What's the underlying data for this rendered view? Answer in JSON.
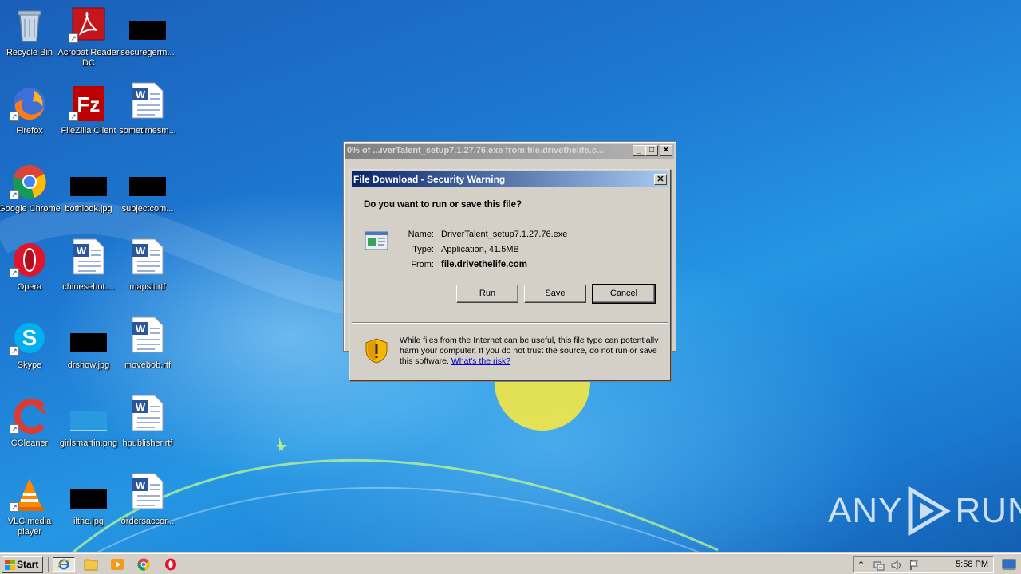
{
  "desktop": {
    "icons": [
      {
        "label": "Recycle Bin",
        "icon": "recycle-bin-icon"
      },
      {
        "label": "Acrobat Reader DC",
        "icon": "acrobat-reader-icon"
      },
      {
        "label": "securegerm...",
        "icon": "image-thumbnail-icon"
      },
      {
        "label": "Firefox",
        "icon": "firefox-icon"
      },
      {
        "label": "FileZilla Client",
        "icon": "filezilla-icon"
      },
      {
        "label": "sometimesm...",
        "icon": "word-document-icon"
      },
      {
        "label": "Google Chrome",
        "icon": "chrome-icon"
      },
      {
        "label": "bothlook.jpg",
        "icon": "image-thumbnail-icon"
      },
      {
        "label": "subjectcom...",
        "icon": "image-thumbnail-icon"
      },
      {
        "label": "Opera",
        "icon": "opera-icon"
      },
      {
        "label": "chinesehot....",
        "icon": "word-document-icon"
      },
      {
        "label": "mapsit.rtf",
        "icon": "word-document-icon"
      },
      {
        "label": "Skype",
        "icon": "skype-icon"
      },
      {
        "label": "drshow.jpg",
        "icon": "image-thumbnail-icon"
      },
      {
        "label": "movebob.rtf",
        "icon": "word-document-icon"
      },
      {
        "label": "CCleaner",
        "icon": "ccleaner-icon"
      },
      {
        "label": "girlsmartin.png",
        "icon": "image-thumbnail-icon"
      },
      {
        "label": "hpublisher.rtf",
        "icon": "word-document-icon"
      },
      {
        "label": "VLC media player",
        "icon": "vlc-icon"
      },
      {
        "label": "ilthe.jpg",
        "icon": "image-thumbnail-icon"
      },
      {
        "label": "ordersaccor...",
        "icon": "word-document-icon"
      }
    ]
  },
  "watermark": {
    "left": "ANY",
    "right": "RUN"
  },
  "ie_window": {
    "title": "0% of ...iverTalent_setup7.1.27.76.exe from file.drivethelife.c...",
    "minimize": "_",
    "maximize": "□",
    "close": "✕"
  },
  "dialog": {
    "title": "File Download - Security Warning",
    "close": "✕",
    "question": "Do you want to run or save this file?",
    "name_label": "Name:",
    "name_value": "DriverTalent_setup7.1.27.76.exe",
    "type_label": "Type:",
    "type_value": "Application, 41.5MB",
    "from_label": "From:",
    "from_value": "file.drivethelife.com",
    "run_button": "Run",
    "save_button": "Save",
    "cancel_button": "Cancel",
    "warning_text": "While files from the Internet can be useful, this file type can potentially harm your computer. If you do not trust the source, do not run or save this software.",
    "warning_link": "What's the risk?"
  },
  "taskbar": {
    "start_label": "Start",
    "clock": "5:58 PM",
    "tray_expand": "⌃"
  },
  "colors": {
    "dialog_title_start": "#0a246a",
    "dialog_title_end": "#a6caf0",
    "inactive_title": "#808080",
    "classic_face": "#d4d0c8"
  }
}
